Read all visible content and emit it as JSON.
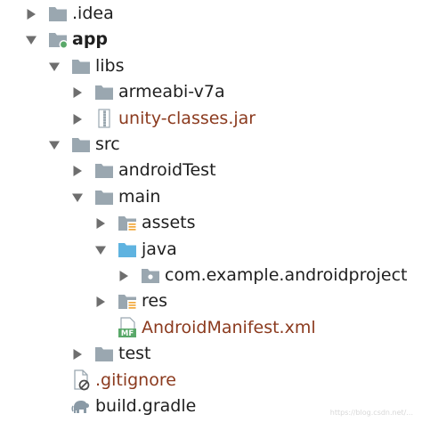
{
  "tree": [
    {
      "name": "idea",
      "label": ".idea",
      "depth": 0,
      "expander": "collapsed",
      "icon": "folder-icon",
      "style": "normal"
    },
    {
      "name": "app",
      "label": "app",
      "depth": 0,
      "expander": "expanded",
      "icon": "module-folder-icon",
      "style": "bold"
    },
    {
      "name": "libs",
      "label": "libs",
      "depth": 1,
      "expander": "expanded",
      "icon": "folder-icon",
      "style": "normal"
    },
    {
      "name": "armeabi",
      "label": "armeabi-v7a",
      "depth": 2,
      "expander": "collapsed",
      "icon": "folder-icon",
      "style": "normal"
    },
    {
      "name": "unity-jar",
      "label": "unity-classes.jar",
      "depth": 2,
      "expander": "collapsed",
      "icon": "jar-file-icon",
      "style": "brown"
    },
    {
      "name": "src",
      "label": "src",
      "depth": 1,
      "expander": "expanded",
      "icon": "folder-icon",
      "style": "normal"
    },
    {
      "name": "androidtest",
      "label": "androidTest",
      "depth": 2,
      "expander": "collapsed",
      "icon": "folder-icon",
      "style": "normal"
    },
    {
      "name": "main",
      "label": "main",
      "depth": 2,
      "expander": "expanded",
      "icon": "folder-icon",
      "style": "normal"
    },
    {
      "name": "assets",
      "label": "assets",
      "depth": 3,
      "expander": "collapsed",
      "icon": "resources-folder-icon",
      "style": "normal"
    },
    {
      "name": "java",
      "label": "java",
      "depth": 3,
      "expander": "expanded",
      "icon": "source-folder-icon",
      "style": "normal"
    },
    {
      "name": "package",
      "label": "com.example.androidproject",
      "depth": 4,
      "expander": "collapsed",
      "icon": "package-icon",
      "style": "normal"
    },
    {
      "name": "res",
      "label": "res",
      "depth": 3,
      "expander": "collapsed",
      "icon": "resources-folder-icon",
      "style": "normal"
    },
    {
      "name": "manifest",
      "label": "AndroidManifest.xml",
      "depth": 3,
      "expander": "none",
      "icon": "manifest-file-icon",
      "style": "brown"
    },
    {
      "name": "test",
      "label": "test",
      "depth": 2,
      "expander": "collapsed",
      "icon": "folder-icon",
      "style": "normal"
    },
    {
      "name": "gitignore",
      "label": ".gitignore",
      "depth": 1,
      "expander": "none",
      "icon": "ignored-file-icon",
      "style": "brown"
    },
    {
      "name": "build-gradle",
      "label": "build.gradle",
      "depth": 1,
      "expander": "none",
      "icon": "gradle-elephant-icon",
      "style": "normal"
    }
  ],
  "colors": {
    "folder": "#9aa7b0",
    "arrow": "#6e6e6e",
    "source_folder": "#5fb3e0",
    "module_dot": "#59a869",
    "manifest_badge": "#59a869",
    "resource_lines": "#f2a93b",
    "brown_text": "#8b3a1e"
  },
  "watermark": "https://blog.csdn.net/..."
}
